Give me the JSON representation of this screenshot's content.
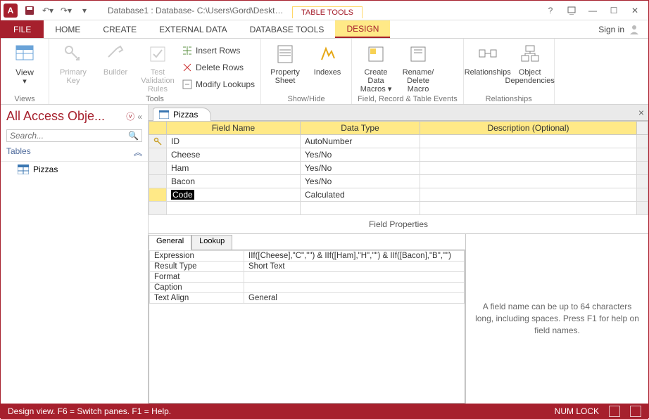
{
  "titlebar": {
    "path": "Database1 : Database- C:\\Users\\Gord\\Desktop\\D...",
    "context_tab": "TABLE TOOLS"
  },
  "ribbon_tabs": {
    "file": "FILE",
    "home": "HOME",
    "create": "CREATE",
    "external": "EXTERNAL DATA",
    "dbtools": "DATABASE TOOLS",
    "design": "DESIGN",
    "signin": "Sign in"
  },
  "ribbon": {
    "views": {
      "view": "View",
      "group": "Views"
    },
    "tools": {
      "primary_key": "Primary Key",
      "builder": "Builder",
      "test_validation": "Test Validation Rules",
      "insert_rows": "Insert Rows",
      "delete_rows": "Delete Rows",
      "modify_lookups": "Modify Lookups",
      "group": "Tools"
    },
    "showhide": {
      "property_sheet": "Property Sheet",
      "indexes": "Indexes",
      "group": "Show/Hide"
    },
    "events": {
      "create_macros": "Create Data Macros ▾",
      "rename_delete": "Rename/ Delete Macro",
      "group": "Field, Record & Table Events"
    },
    "relationships": {
      "relationships": "Relationships",
      "object_deps": "Object Dependencies",
      "group": "Relationships"
    }
  },
  "nav": {
    "title": "All Access Obje...",
    "search_placeholder": "Search...",
    "group": "Tables",
    "items": [
      "Pizzas"
    ]
  },
  "doc_tab": "Pizzas",
  "design_grid": {
    "headers": {
      "field": "Field Name",
      "type": "Data Type",
      "desc": "Description (Optional)"
    },
    "rows": [
      {
        "pk": true,
        "field": "ID",
        "type": "AutoNumber",
        "desc": ""
      },
      {
        "pk": false,
        "field": "Cheese",
        "type": "Yes/No",
        "desc": ""
      },
      {
        "pk": false,
        "field": "Ham",
        "type": "Yes/No",
        "desc": ""
      },
      {
        "pk": false,
        "field": "Bacon",
        "type": "Yes/No",
        "desc": ""
      },
      {
        "pk": false,
        "field": "Code",
        "type": "Calculated",
        "desc": "",
        "active": true
      }
    ]
  },
  "field_props_label": "Field Properties",
  "prop_tabs": {
    "general": "General",
    "lookup": "Lookup"
  },
  "properties": [
    {
      "name": "Expression",
      "value": "IIf([Cheese],\"C\",\"\") & IIf([Ham],\"H\",\"\") & IIf([Bacon],\"B\",\"\")"
    },
    {
      "name": "Result Type",
      "value": "Short Text"
    },
    {
      "name": "Format",
      "value": ""
    },
    {
      "name": "Caption",
      "value": ""
    },
    {
      "name": "Text Align",
      "value": "General"
    }
  ],
  "help_text": "A field name can be up to 64 characters long, including spaces. Press F1 for help on field names.",
  "statusbar": {
    "left": "Design view.  F6 = Switch panes.  F1 = Help.",
    "numlock": "NUM LOCK"
  }
}
